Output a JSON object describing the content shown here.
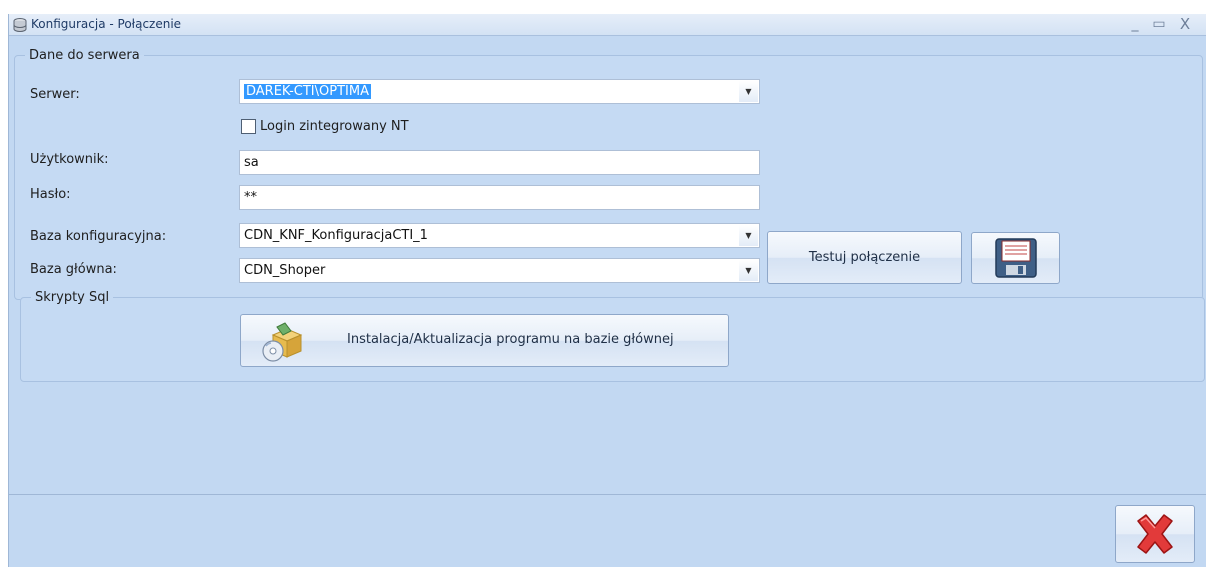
{
  "window": {
    "title": "Konfiguracja - Połączenie",
    "controls": {
      "minimize": "_",
      "maximize": "▭",
      "close": "X"
    }
  },
  "server_group": {
    "legend": "Dane do serwera",
    "server_label": "Serwer:",
    "server_value": "DAREK-CTI\\OPTIMA",
    "nt_login_label": "Login zintegrowany NT",
    "nt_login_checked": false,
    "user_label": "Użytkownik:",
    "user_value": "sa",
    "password_label": "Hasło:",
    "password_value": "**",
    "config_db_label": "Baza konfiguracyjna:",
    "config_db_value": "CDN_KNF_KonfiguracjaCTI_1",
    "main_db_label": "Baza główna:",
    "main_db_value": "CDN_Shoper",
    "test_button": "Testuj połączenie",
    "save_icon": "floppy-disk-icon"
  },
  "scripts_group": {
    "legend": "Skrypty Sql",
    "install_button": "Instalacja/Aktualizacja programu na bazie głównej",
    "install_icon": "install-package-icon"
  },
  "footer": {
    "close_icon": "red-x-icon"
  }
}
